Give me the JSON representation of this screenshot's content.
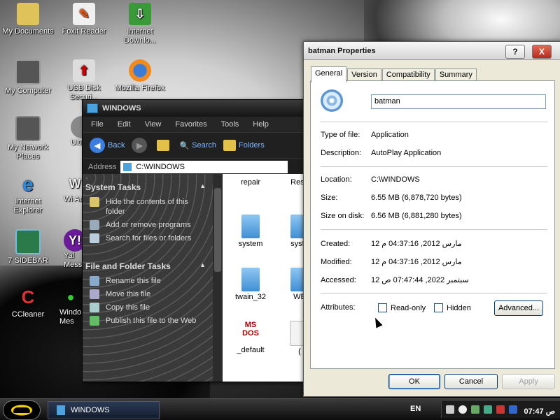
{
  "desktop": {
    "icons": [
      {
        "label": "My Documents"
      },
      {
        "label": "Foxit Reader"
      },
      {
        "label": "Internet Downlo..."
      },
      {
        "label": "My Computer"
      },
      {
        "label": "USB Disk Securi..."
      },
      {
        "label": "Mozilla Firefox"
      },
      {
        "label": "My Network Places"
      },
      {
        "label": "Ulti"
      },
      {
        "label": "Internet Explorer"
      },
      {
        "label": "Wi Audi"
      },
      {
        "label": "7 SIDEBAR"
      },
      {
        "label": "Yal Mess"
      },
      {
        "label": "CCleaner"
      },
      {
        "label": "Windo Mes"
      }
    ]
  },
  "explorer": {
    "title": "WINDOWS",
    "menu": [
      "File",
      "Edit",
      "View",
      "Favorites",
      "Tools",
      "Help"
    ],
    "toolbar": {
      "back": "Back",
      "search": "Search",
      "folders": "Folders"
    },
    "address_label": "Address",
    "address_value": "C:\\WINDOWS",
    "system_tasks_title": "System Tasks",
    "system_tasks": [
      "Hide the contents of this folder",
      "Add or remove programs",
      "Search for files or folders"
    ],
    "file_tasks_title": "File and Folder Tasks",
    "file_tasks": [
      "Rename this file",
      "Move this file",
      "Copy this file",
      "Publish this file to the Web"
    ],
    "files": [
      "repair",
      "Reso",
      "system",
      "syste",
      "twain_32",
      "WB",
      "_default",
      "("
    ]
  },
  "properties": {
    "title": "batman Properties",
    "help_btn": "?",
    "close_btn": "X",
    "tabs": [
      "General",
      "Version",
      "Compatibility",
      "Summary"
    ],
    "name": "batman",
    "type_label": "Type of file:",
    "type_value": "Application",
    "desc_label": "Description:",
    "desc_value": "AutoPlay Application",
    "location_label": "Location:",
    "location_value": "C:\\WINDOWS",
    "size_label": "Size:",
    "size_value": "6.55 MB (6,878,720 bytes)",
    "size_disk_label": "Size on disk:",
    "size_disk_value": "6.56 MB (6,881,280 bytes)",
    "created_label": "Created:",
    "created_value": "12 مارس 2012, 04:37:16 م",
    "modified_label": "Modified:",
    "modified_value": "12 مارس 2012, 04:37:16 م",
    "accessed_label": "Accessed:",
    "accessed_value": "12 سبتمبر 2022, 07:47:44 ص",
    "attributes_label": "Attributes:",
    "readonly_label": "Read-only",
    "hidden_label": "Hidden",
    "advanced_btn": "Advanced...",
    "ok_btn": "OK",
    "cancel_btn": "Cancel",
    "apply_btn": "Apply"
  },
  "taskbar": {
    "task_label": "WINDOWS",
    "language": "EN",
    "clock": "07:47 ص"
  }
}
